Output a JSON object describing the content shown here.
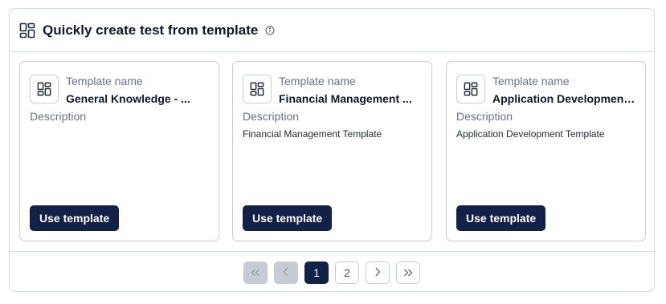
{
  "header": {
    "title": "Quickly create test from template",
    "icon": "grid-template-icon",
    "info_icon": "info-icon"
  },
  "cards": [
    {
      "name_label": "Template name",
      "name": "General Knowledge - ...",
      "description_label": "Description",
      "description": "",
      "button_label": "Use template"
    },
    {
      "name_label": "Template name",
      "name": "Financial Management ...",
      "description_label": "Description",
      "description": "Financial Management Template",
      "button_label": "Use template"
    },
    {
      "name_label": "Template name",
      "name": "Application Development...",
      "description_label": "Description",
      "description": "Application Development Template",
      "button_label": "Use template"
    }
  ],
  "pagination": {
    "first_icon": "double-chevron-left-icon",
    "prev_icon": "chevron-left-icon",
    "pages": [
      "1",
      "2"
    ],
    "current_page": "1",
    "next_icon": "chevron-right-icon",
    "last_icon": "double-chevron-right-icon"
  },
  "colors": {
    "primary": "#132047",
    "border": "#d6dae1",
    "disabled": "#c7ccd4",
    "muted_text": "#6b7280"
  }
}
